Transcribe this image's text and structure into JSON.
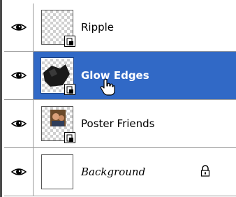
{
  "layers_panel": {
    "layers": [
      {
        "name": "Ripple",
        "selected": false,
        "visible": true,
        "thumbnail": "transparent-with-link-badge"
      },
      {
        "name": "Glow Edges",
        "selected": true,
        "visible": true,
        "thumbnail": "dark-image-with-link-badge"
      },
      {
        "name": "Poster Friends",
        "selected": false,
        "visible": true,
        "thumbnail": "photo-with-link-badge"
      },
      {
        "name": "Background",
        "selected": false,
        "visible": true,
        "thumbnail": "white",
        "locked": true
      }
    ],
    "icons": {
      "visibility": "eye-icon",
      "lock": "lock-icon",
      "link_badge": "smart-object-link-icon",
      "cursor": "hand-pointer-cursor-icon"
    },
    "colors": {
      "selection": "#3169c6",
      "row_background": "#ffffff",
      "separator": "#9c9c9c"
    }
  }
}
